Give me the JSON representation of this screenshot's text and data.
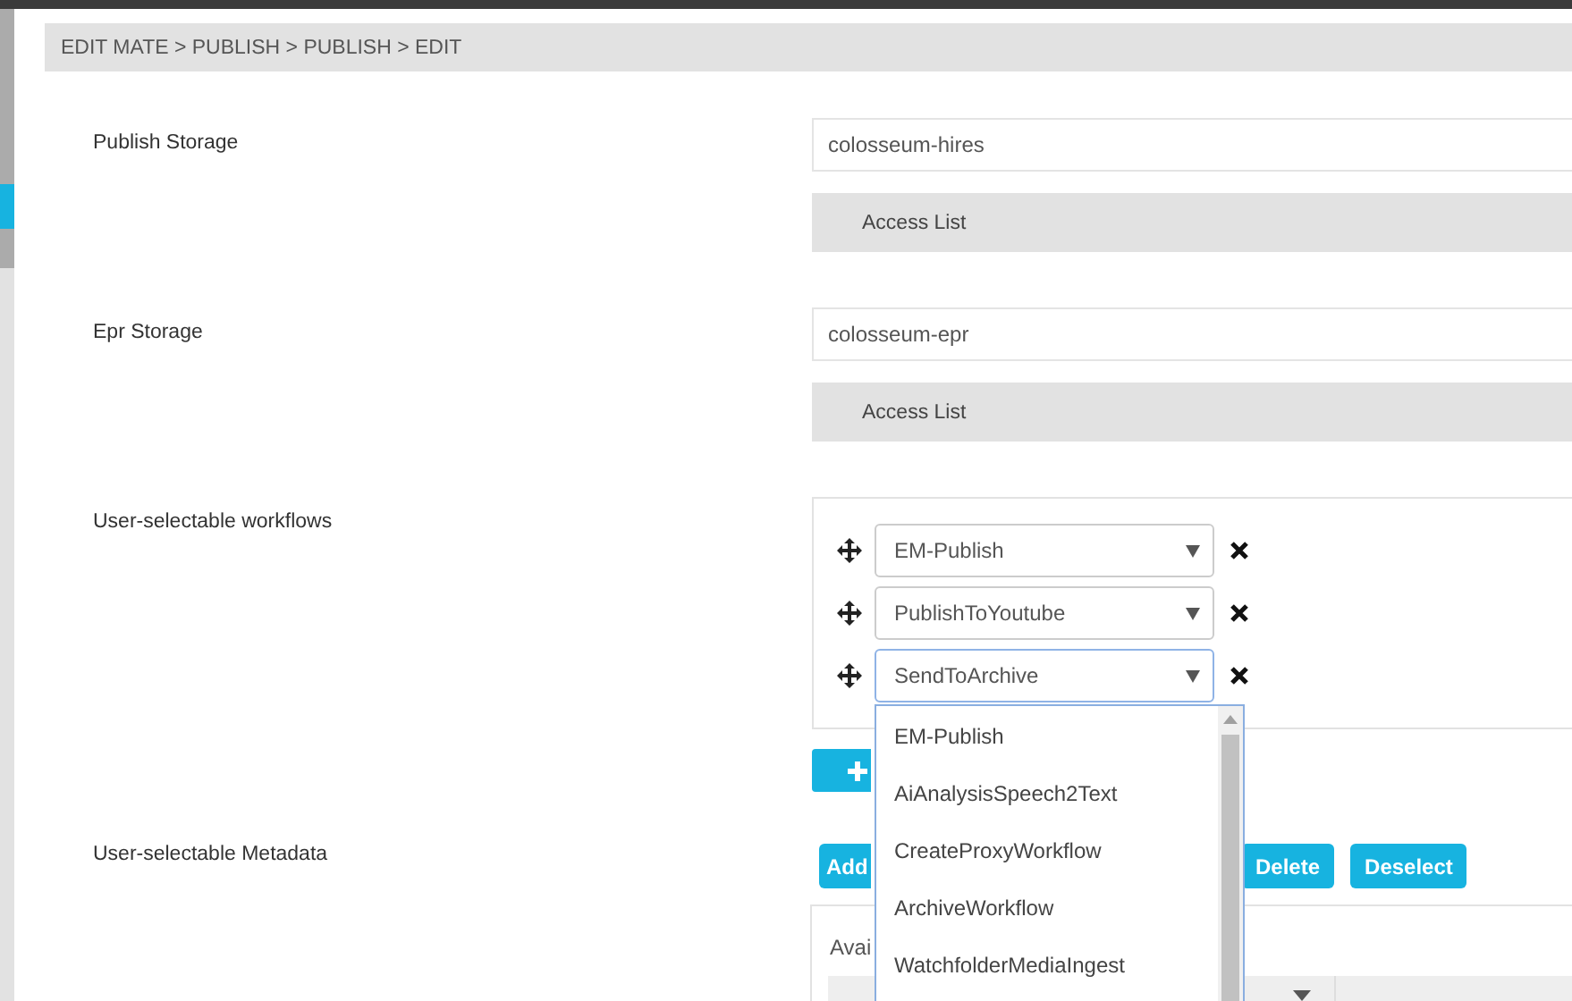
{
  "breadcrumb": "EDIT MATE > PUBLISH > PUBLISH > EDIT",
  "storages": [
    {
      "label": "Publish Storage",
      "value": "colosseum-hires",
      "access_button": "Access List"
    },
    {
      "label": "Epr Storage",
      "value": "colosseum-epr",
      "access_button": "Access List"
    }
  ],
  "workflows": {
    "label": "User-selectable workflows",
    "items": [
      {
        "value": "EM-Publish",
        "open": false
      },
      {
        "value": "PublishToYoutube",
        "open": false
      },
      {
        "value": "SendToArchive",
        "open": true
      }
    ],
    "dropdown_options": [
      "EM-Publish",
      "AiAnalysisSpeech2Text",
      "CreateProxyWorkflow",
      "ArchiveWorkflow",
      "WatchfolderMediaIngest"
    ]
  },
  "metadata": {
    "label": "User-selectable Metadata",
    "buttons": [
      "Add",
      "Delete",
      "Deselect"
    ],
    "panel_title": "Avai"
  }
}
